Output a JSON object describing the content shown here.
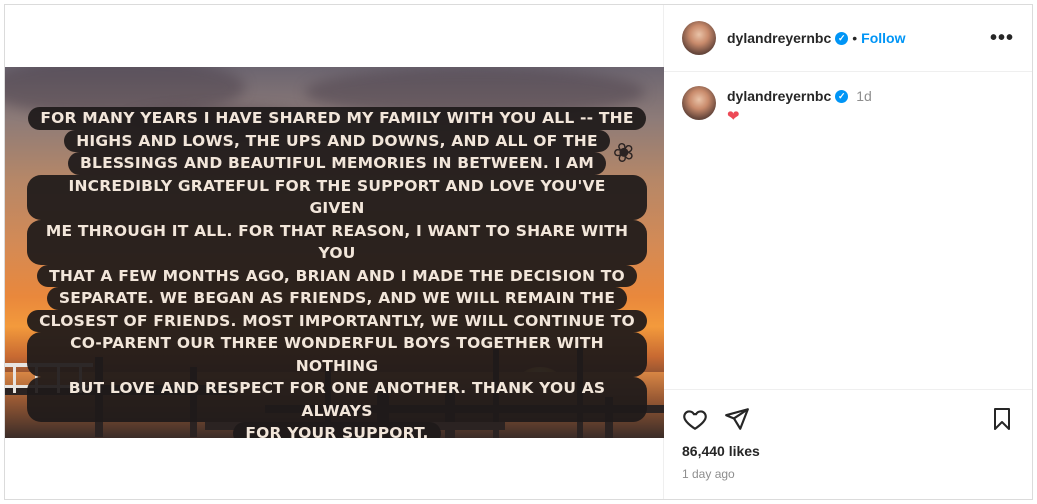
{
  "post": {
    "username": "dylandreyernbc",
    "follow_label": "Follow",
    "separator": "•",
    "more_label": "•••"
  },
  "image_caption_lines": [
    "FOR MANY YEARS I HAVE SHARED MY FAMILY WITH YOU ALL -- THE",
    "HIGHS AND LOWS, THE UPS AND DOWNS, AND ALL OF THE",
    "BLESSINGS AND BEAUTIFUL MEMORIES IN BETWEEN. I AM",
    "INCREDIBLY GRATEFUL FOR THE SUPPORT AND LOVE YOU'VE GIVEN",
    "ME THROUGH IT ALL. FOR THAT REASON, I WANT TO SHARE WITH YOU",
    "THAT A FEW MONTHS AGO, BRIAN AND I MADE THE DECISION TO",
    "SEPARATE. WE BEGAN AS FRIENDS, AND WE WILL REMAIN THE",
    "CLOSEST OF FRIENDS.  MOST IMPORTANTLY, WE WILL CONTINUE TO",
    "CO-PARENT OUR THREE WONDERFUL BOYS TOGETHER WITH NOTHING",
    "BUT LOVE AND RESPECT FOR ONE ANOTHER.  THANK YOU AS ALWAYS",
    "FOR YOUR SUPPORT."
  ],
  "comment": {
    "username": "dylandreyernbc",
    "time": "1d",
    "text": "❤"
  },
  "footer": {
    "likes": "86,440 likes",
    "posted": "1 day ago"
  },
  "icons": {
    "verified": "verified-badge-icon",
    "like": "heart-icon",
    "share": "paper-plane-icon",
    "save": "bookmark-icon",
    "more": "more-options-icon"
  },
  "colors": {
    "accent": "#0095f6",
    "heart": "#ed4956",
    "muted": "#8e8e8e"
  }
}
